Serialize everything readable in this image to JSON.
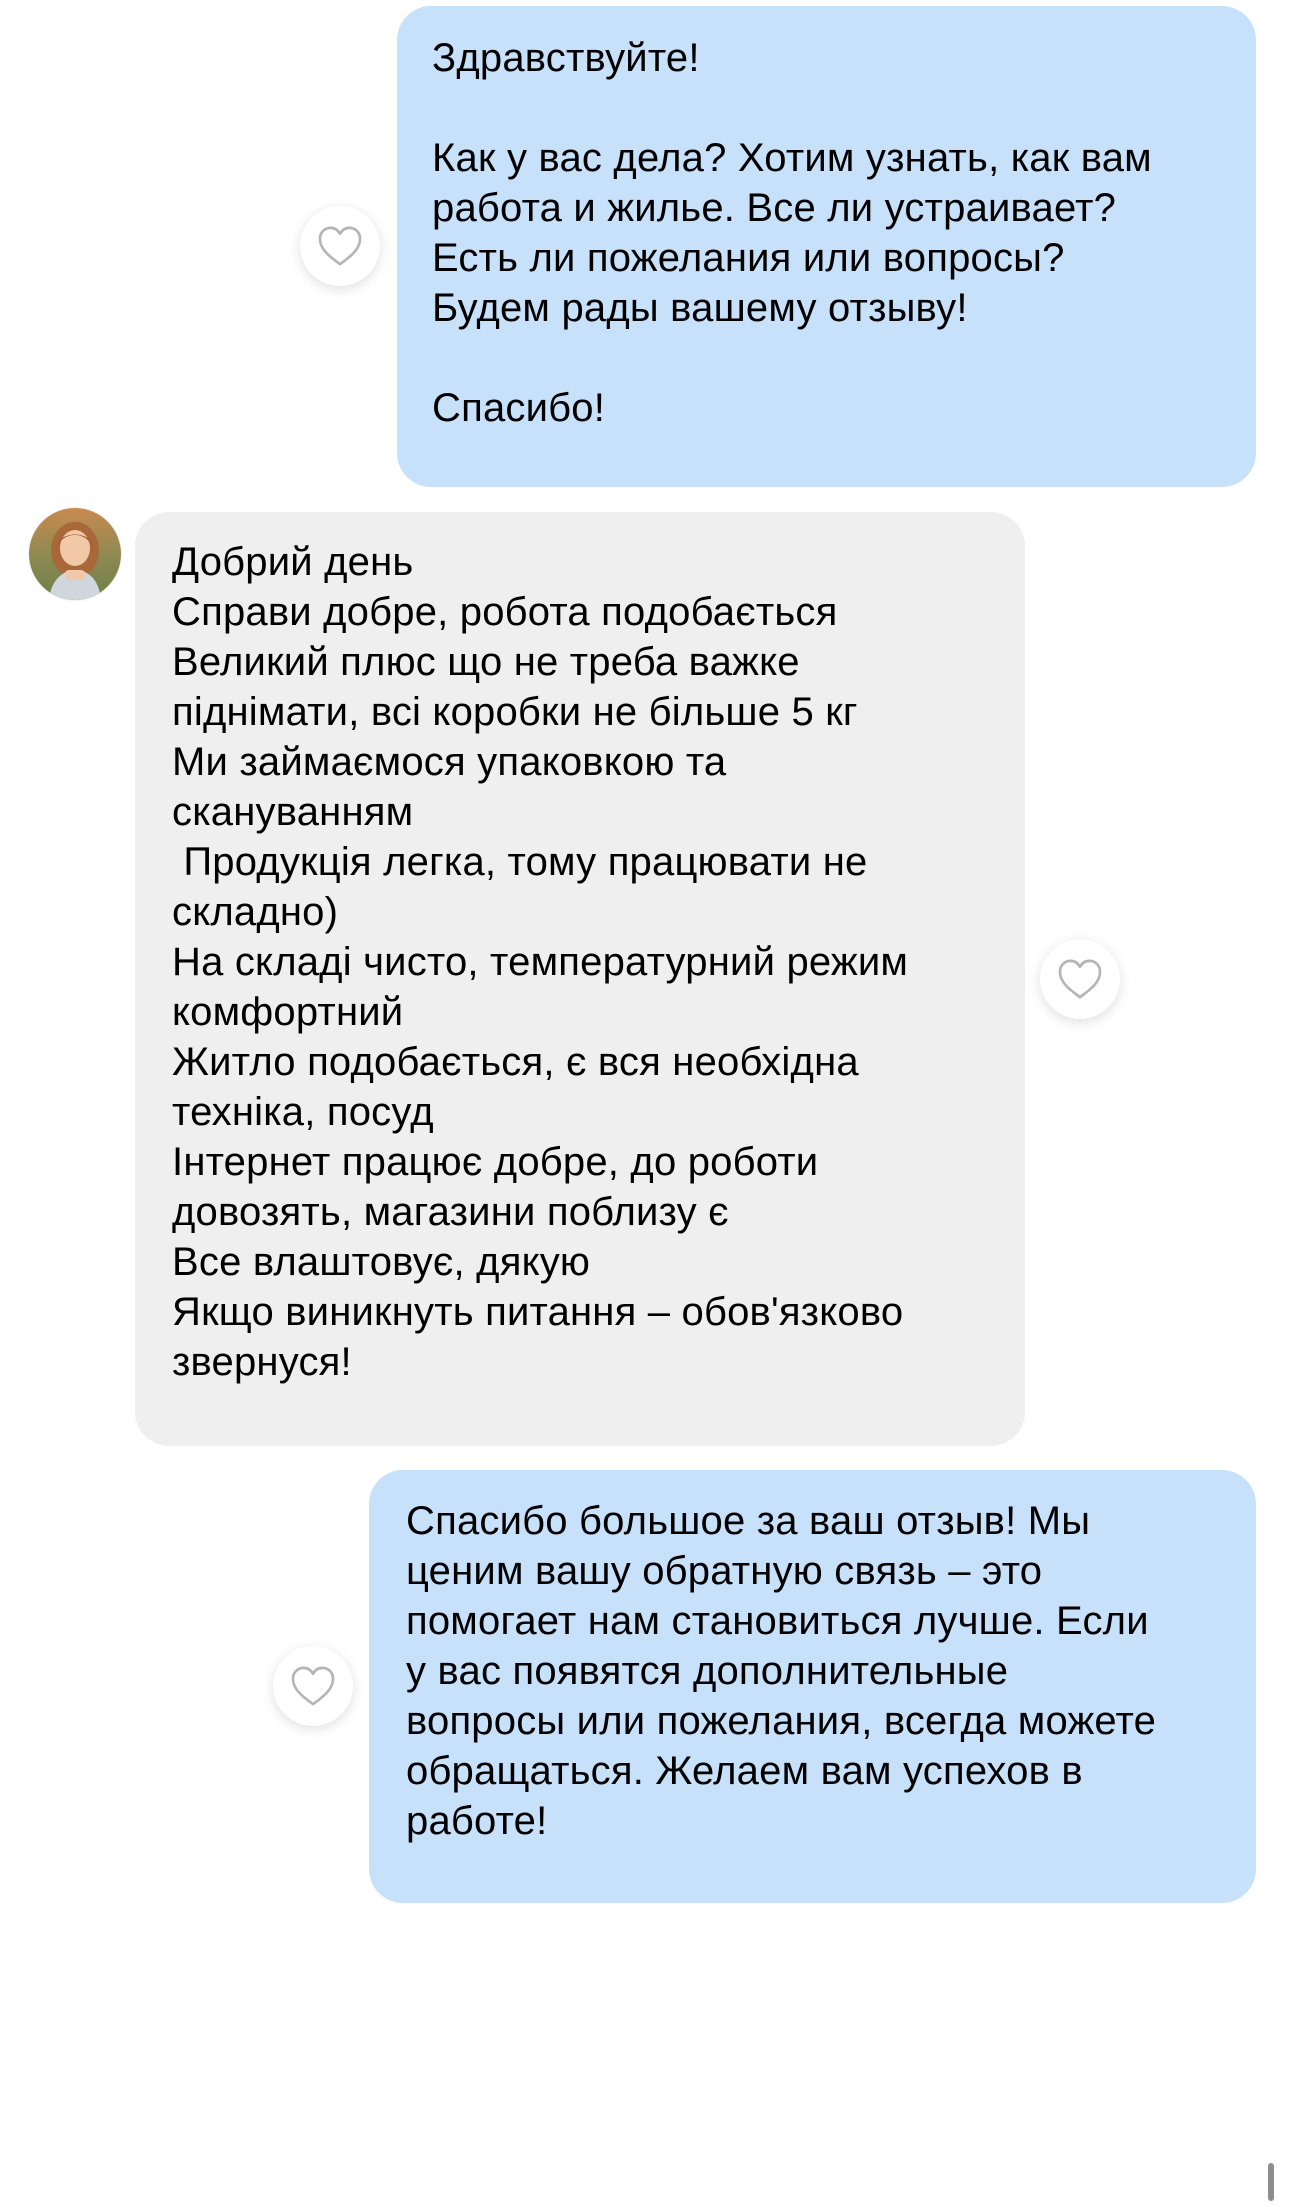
{
  "chat": {
    "messages": [
      {
        "direction": "outgoing",
        "lines": [
          "Здравствуйте!",
          "",
          "Как у вас дела? Хотим узнать, как вам",
          "работа и жилье. Все ли устраивает?",
          "Есть ли пожелания или вопросы?",
          "Будем рады вашему отзыву!",
          "",
          "Спасибо!"
        ]
      },
      {
        "direction": "incoming",
        "lines": [
          "Добрий день",
          "Справи добре, робота подобається",
          "Великий плюс що не треба важке",
          "піднімати, всі коробки не більше 5 кг",
          "Ми займаємося упаковкою та",
          "скануванням",
          " Продукція легка, тому працювати не",
          "складно)",
          "На складі чисто, температурний режим",
          "комфортний",
          "Житло подобається, є вся необхідна",
          "техніка, посуд",
          "Інтернет працює добре, до роботи",
          "довозять, магазини поблизу є",
          "Все влаштовує, дякую",
          "Якщо виникнуть питання – обов'язково",
          "звернуся!"
        ]
      },
      {
        "direction": "outgoing",
        "lines": [
          "Спасибо большое за ваш отзыв! Мы",
          "ценим вашу обратную связь – это",
          "помогает нам становиться лучше. Если",
          "у вас появятся дополнительные",
          "вопросы или пожелания, всегда можете",
          "обращаться. Желаем вам успехов в",
          "работе!"
        ]
      }
    ]
  },
  "icons": {
    "like": "heart-outline-icon",
    "avatar": "contact-avatar"
  },
  "colors": {
    "outgoing_bubble": "#c7e1fb",
    "incoming_bubble": "#efefef",
    "heart_stroke": "#b5b5b5",
    "text": "#000000"
  }
}
